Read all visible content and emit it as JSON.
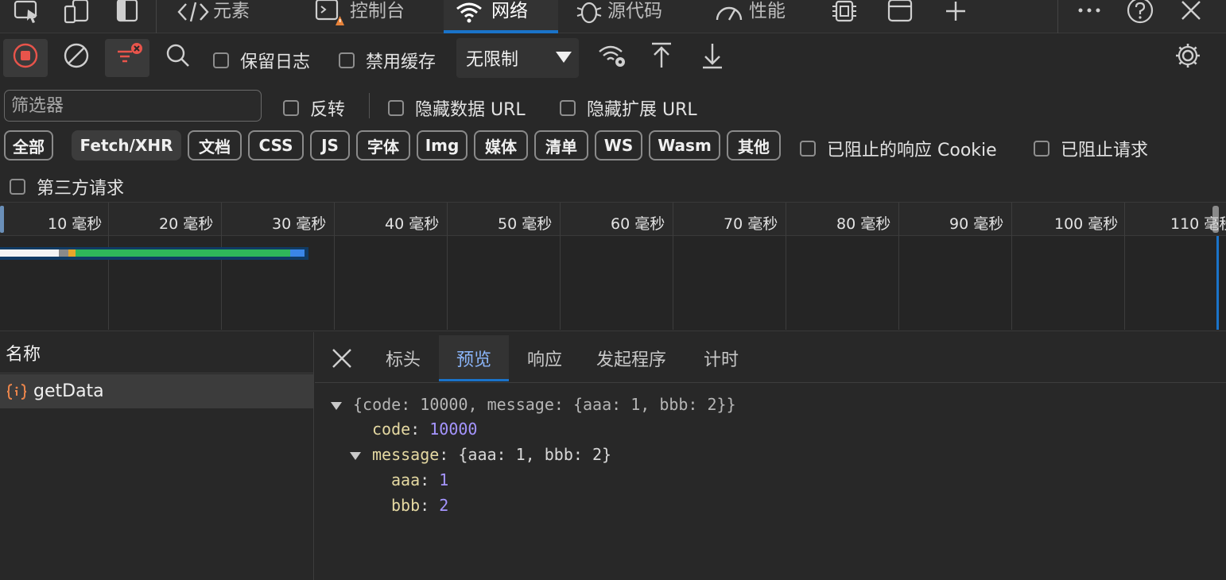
{
  "tabs": {
    "elements": "元素",
    "console": "控制台",
    "network": "网络",
    "sources": "源代码",
    "performance": "性能"
  },
  "toolbar": {
    "preserve_log": "保留日志",
    "disable_cache": "禁用缓存",
    "throttling": "无限制"
  },
  "filter": {
    "placeholder": "筛选器",
    "invert": "反转",
    "hide_data_urls": "隐藏数据 URL",
    "hide_extension_urls": "隐藏扩展 URL",
    "types": [
      "全部",
      "Fetch/XHR",
      "文档",
      "CSS",
      "JS",
      "字体",
      "Img",
      "媒体",
      "清单",
      "WS",
      "Wasm",
      "其他"
    ],
    "active_type": "Fetch/XHR",
    "blocked_response_cookies": "已阻止的响应 Cookie",
    "blocked_requests": "已阻止请求",
    "third_party": "第三方请求"
  },
  "timeline": {
    "ticks": [
      "10 毫秒",
      "20 毫秒",
      "30 毫秒",
      "40 毫秒",
      "50 毫秒",
      "60 毫秒",
      "70 毫秒",
      "80 毫秒",
      "90 毫秒",
      "100 毫秒",
      "110 毫秒"
    ]
  },
  "requests": {
    "column_name": "名称",
    "items": [
      {
        "name": "getData"
      }
    ]
  },
  "details": {
    "tabs": [
      "标头",
      "预览",
      "响应",
      "发起程序",
      "计时"
    ],
    "active_tab": "预览",
    "preview": {
      "summary": "{code: 10000, message: {aaa: 1, bbb: 2}}",
      "code_key": "code",
      "code_value": "10000",
      "message_key": "message",
      "message_summary": "{aaa: 1, bbb: 2}",
      "aaa_key": "aaa",
      "aaa_value": "1",
      "bbb_key": "bbb",
      "bbb_value": "2"
    }
  },
  "colors": {
    "accent": "#1a73c9",
    "record_red": "#e8544b",
    "waterfall_green": "#2fb65a",
    "waterfall_blue": "#3a86e8",
    "json_key": "#e5d9a2",
    "json_number": "#a595ff"
  }
}
